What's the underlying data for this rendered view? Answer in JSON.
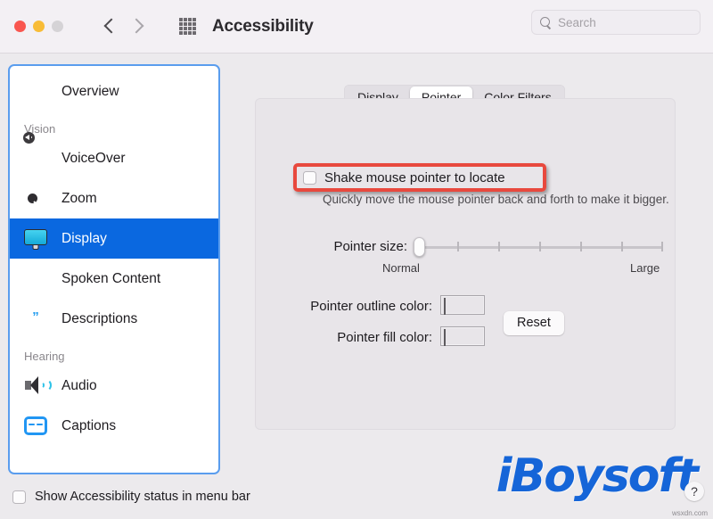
{
  "window": {
    "title": "Accessibility",
    "traffic_lights": [
      "close",
      "minimize",
      "zoom"
    ],
    "back_label": "Back",
    "forward_label": "Forward",
    "grid_label": "Show All"
  },
  "search": {
    "placeholder": "Search",
    "value": "",
    "icon": "search-icon"
  },
  "sidebar": {
    "items": [
      {
        "label": "Overview",
        "icon": "accessibility-icon",
        "selected": false
      },
      {
        "label": "VoiceOver",
        "icon": "voiceover-icon",
        "selected": false
      },
      {
        "label": "Zoom",
        "icon": "zoom-icon",
        "selected": false
      },
      {
        "label": "Display",
        "icon": "display-icon",
        "selected": true
      },
      {
        "label": "Spoken Content",
        "icon": "spoken-content-icon",
        "selected": false
      },
      {
        "label": "Descriptions",
        "icon": "descriptions-icon",
        "selected": false
      },
      {
        "label": "Audio",
        "icon": "audio-icon",
        "selected": false
      },
      {
        "label": "Captions",
        "icon": "captions-icon",
        "selected": false
      }
    ],
    "headings": {
      "vision": "Vision",
      "hearing": "Hearing"
    }
  },
  "main": {
    "tabs": [
      {
        "label": "Display",
        "active": false
      },
      {
        "label": "Pointer",
        "active": true
      },
      {
        "label": "Color Filters",
        "active": false
      }
    ],
    "shake": {
      "label": "Shake mouse pointer to locate",
      "checked": false,
      "description": "Quickly move the mouse pointer back and forth to make it bigger."
    },
    "pointer_size": {
      "label": "Pointer size:",
      "min_label": "Normal",
      "max_label": "Large",
      "value": 0,
      "ticks": 6
    },
    "outline_color": {
      "label": "Pointer outline color:",
      "value": "#ffffff"
    },
    "fill_color": {
      "label": "Pointer fill color:",
      "value": "#000000"
    },
    "reset_label": "Reset",
    "highlight_color": "#e8493e"
  },
  "footer": {
    "show_status_label": "Show Accessibility status in menu bar",
    "show_status_checked": false,
    "help_label": "?"
  },
  "watermark": {
    "brand": "iBoysoft",
    "site": "wsxdn.com"
  },
  "colors": {
    "accent": "#0a68e0",
    "window_bg": "#eceaed",
    "toolbar_bg": "#f3f0f4",
    "panel_bg": "#e8e5e9",
    "sidebar_focus": "#5a9dee"
  }
}
